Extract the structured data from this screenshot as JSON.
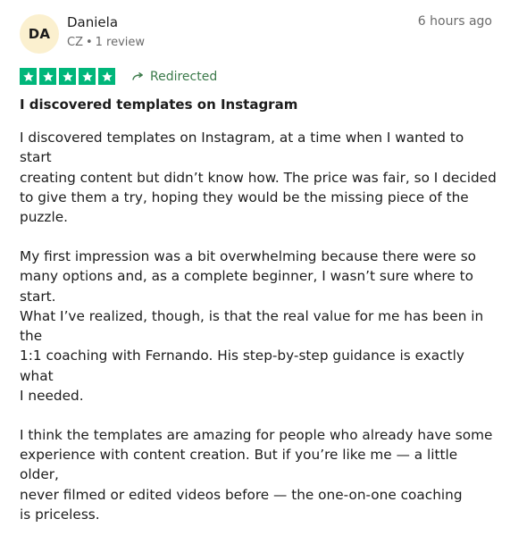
{
  "reviewer": {
    "initials": "DA",
    "name": "Daniela",
    "country": "CZ",
    "review_count": "1 review"
  },
  "timestamp": "6 hours ago",
  "rating": {
    "stars": 5,
    "max": 5
  },
  "redirected_label": "Redirected",
  "title": "I discovered templates on Instagram",
  "body": {
    "p1_lines": [
      "I discovered templates on Instagram, at a time when I wanted to start",
      "creating content but didn’t know how. The price was fair, so I decided",
      "to give them a try, hoping they would be the missing piece of the puzzle."
    ],
    "p2_lines": [
      "My first impression was a bit overwhelming because there were so",
      "many options and, as a complete beginner, I wasn’t sure where to start.",
      "What I’ve realized, though, is that the real value for me has been in the",
      "1:1 coaching with Fernando. His step-by-step guidance is exactly what",
      "I needed."
    ],
    "p3_lines": [
      "I think the templates are amazing for people who already have some",
      "experience with content creation. But if you’re like me — a little older,",
      "never filmed or edited videos before — the one-on-one coaching",
      "is priceless."
    ]
  },
  "colors": {
    "star_green": "#00b67a",
    "avatar_bg": "#fbf0cf",
    "redirected_green": "#3b7a4a"
  },
  "icons": {
    "star": "star-icon",
    "redirect": "redirect-arrow-icon"
  }
}
